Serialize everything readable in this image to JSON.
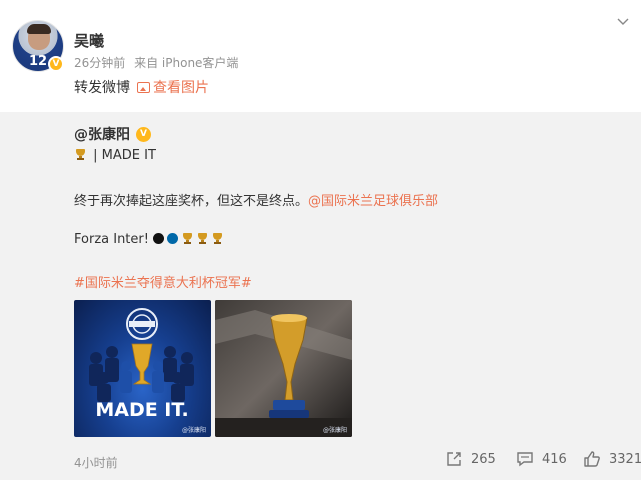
{
  "post": {
    "user_name": "吴曦",
    "time": "26分钟前",
    "source": "来自 iPhone客户端",
    "repost_label": "转发微博",
    "view_pic_label": "查看图片",
    "avatar_number": "12",
    "verified_mark": "V"
  },
  "original": {
    "author": "@张康阳",
    "verified_mark": "V",
    "line1": "| MADE IT",
    "line2_text": "终于再次捧起这座奖杯，但这不是终点。",
    "line2_mention": "@国际米兰足球俱乐部",
    "line3_text": "Forza Inter!",
    "hashtag": "#国际米兰夺得意大利杯冠军#",
    "photo1_caption": "MADE IT.",
    "photo1_watermark": "@张康阳",
    "photo2_watermark": "@张康阳",
    "time": "4小时前",
    "reposts": "265",
    "comments": "416",
    "likes": "3321"
  },
  "colors": {
    "accent": "#eb7350",
    "verified": "#ffb81c",
    "inter_blue": "#0068a8"
  }
}
